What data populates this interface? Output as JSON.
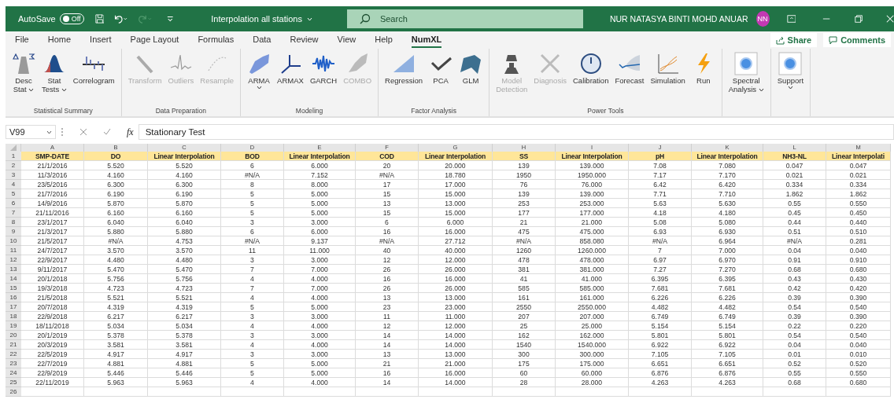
{
  "title_bar": {
    "autosave_label": "AutoSave",
    "autosave": {
      "on": false,
      "label": "Off"
    },
    "filename": "Interpolation all stations",
    "search": {
      "placeholder": "Search"
    },
    "user_name": "NUR NATASYA BINTI MOHD ANUAR",
    "avatar_initials": "NN"
  },
  "menu_tabs": [
    {
      "label": "File",
      "selected": false
    },
    {
      "label": "Home",
      "selected": false
    },
    {
      "label": "Insert",
      "selected": false
    },
    {
      "label": "Page Layout",
      "selected": false
    },
    {
      "label": "Formulas",
      "selected": false
    },
    {
      "label": "Data",
      "selected": false
    },
    {
      "label": "Review",
      "selected": false
    },
    {
      "label": "View",
      "selected": false
    },
    {
      "label": "Help",
      "selected": false
    },
    {
      "label": "NumXL",
      "selected": true
    }
  ],
  "share_button": "Share",
  "comments_button": "Comments",
  "ribbon_groups": [
    {
      "label": "Statistical Summary",
      "items": [
        {
          "lines": [
            "Desc",
            "Stat"
          ],
          "disabled": false,
          "dropdown": true
        },
        {
          "lines": [
            "Stat",
            "Tests"
          ],
          "disabled": false,
          "dropdown": true
        },
        {
          "lines": [
            "Correlogram"
          ],
          "disabled": false,
          "dropdown": false
        }
      ]
    },
    {
      "label": "Data Preparation",
      "items": [
        {
          "lines": [
            "Transform"
          ],
          "disabled": true,
          "dropdown": false
        },
        {
          "lines": [
            "Outliers"
          ],
          "disabled": true,
          "dropdown": false
        },
        {
          "lines": [
            "Resample"
          ],
          "disabled": true,
          "dropdown": false
        }
      ]
    },
    {
      "label": "Modeling",
      "items": [
        {
          "lines": [
            "ARMA"
          ],
          "disabled": false,
          "dropdown": true
        },
        {
          "lines": [
            "ARMAX"
          ],
          "disabled": false,
          "dropdown": false
        },
        {
          "lines": [
            "GARCH"
          ],
          "disabled": false,
          "dropdown": false
        },
        {
          "lines": [
            "COMBO"
          ],
          "disabled": true,
          "dropdown": false
        }
      ]
    },
    {
      "label": "Factor Analysis",
      "items": [
        {
          "lines": [
            "Regression"
          ],
          "disabled": false,
          "dropdown": false
        },
        {
          "lines": [
            "PCA"
          ],
          "disabled": false,
          "dropdown": false
        },
        {
          "lines": [
            "GLM"
          ],
          "disabled": false,
          "dropdown": false
        }
      ]
    },
    {
      "label": "Power Tools",
      "items": [
        {
          "lines": [
            "Model",
            "Detection"
          ],
          "disabled": true,
          "dropdown": false
        },
        {
          "lines": [
            "Diagnosis"
          ],
          "disabled": true,
          "dropdown": false
        },
        {
          "lines": [
            "Calibration"
          ],
          "disabled": false,
          "dropdown": false
        },
        {
          "lines": [
            "Forecast"
          ],
          "disabled": false,
          "dropdown": false
        },
        {
          "lines": [
            "Simulation"
          ],
          "disabled": false,
          "dropdown": false
        },
        {
          "lines": [
            "Run"
          ],
          "disabled": false,
          "dropdown": false
        }
      ]
    },
    {
      "items": [
        {
          "lines": [
            "Spectral",
            "Analysis"
          ],
          "disabled": false,
          "dropdown": true
        }
      ]
    },
    {
      "items": [
        {
          "lines": [
            "Support"
          ],
          "disabled": false,
          "dropdown": true
        }
      ]
    }
  ],
  "formula_bar": {
    "cell_reference": "V99",
    "function_symbol": "fx",
    "formula": "Stationary Test"
  },
  "sheet": {
    "columns": [
      "A",
      "B",
      "C",
      "D",
      "E",
      "F",
      "G",
      "H",
      "I",
      "J",
      "K",
      "L",
      "M"
    ],
    "header": {
      "number": "1",
      "cells": [
        "SMP-DATE",
        "DO",
        "Linear Interpolation",
        "BOD",
        "Linear Interpolation",
        "COD",
        "Linear Interpolation",
        "SS",
        "Linear Interpolation",
        "pH",
        "Linear Interpolation",
        "NH3-NL",
        "Linear Interpolati"
      ]
    },
    "rows": [
      {
        "number": "2",
        "cells": [
          "21/1/2016",
          "5.520",
          "5.520",
          "6",
          "6.000",
          "20",
          "20.000",
          "139",
          "139.000",
          "7.08",
          "7.080",
          "0.047",
          "0.047"
        ]
      },
      {
        "number": "3",
        "cells": [
          "11/3/2016",
          "4.160",
          "4.160",
          "#N/A",
          "7.152",
          "#N/A",
          "18.780",
          "1950",
          "1950.000",
          "7.17",
          "7.170",
          "0.021",
          "0.021"
        ]
      },
      {
        "number": "4",
        "cells": [
          "23/5/2016",
          "6.300",
          "6.300",
          "8",
          "8.000",
          "17",
          "17.000",
          "76",
          "76.000",
          "6.42",
          "6.420",
          "0.334",
          "0.334"
        ]
      },
      {
        "number": "5",
        "cells": [
          "21/7/2016",
          "6.190",
          "6.190",
          "5",
          "5.000",
          "15",
          "15.000",
          "139",
          "139.000",
          "7.71",
          "7.710",
          "1.862",
          "1.862"
        ]
      },
      {
        "number": "6",
        "cells": [
          "14/9/2016",
          "5.870",
          "5.870",
          "5",
          "5.000",
          "13",
          "13.000",
          "253",
          "253.000",
          "5.63",
          "5.630",
          "0.55",
          "0.550"
        ]
      },
      {
        "number": "7",
        "cells": [
          "21/11/2016",
          "6.160",
          "6.160",
          "5",
          "5.000",
          "15",
          "15.000",
          "177",
          "177.000",
          "4.18",
          "4.180",
          "0.45",
          "0.450"
        ]
      },
      {
        "number": "8",
        "cells": [
          "23/1/2017",
          "6.040",
          "6.040",
          "3",
          "3.000",
          "6",
          "6.000",
          "21",
          "21.000",
          "5.08",
          "5.080",
          "0.44",
          "0.440"
        ]
      },
      {
        "number": "9",
        "cells": [
          "21/3/2017",
          "5.880",
          "5.880",
          "6",
          "6.000",
          "16",
          "16.000",
          "475",
          "475.000",
          "6.93",
          "6.930",
          "0.51",
          "0.510"
        ]
      },
      {
        "number": "10",
        "cells": [
          "21/5/2017",
          "#N/A",
          "4.753",
          "#N/A",
          "9.137",
          "#N/A",
          "27.712",
          "#N/A",
          "858.080",
          "#N/A",
          "6.964",
          "#N/A",
          "0.281"
        ]
      },
      {
        "number": "11",
        "cells": [
          "24/7/2017",
          "3.570",
          "3.570",
          "11",
          "11.000",
          "40",
          "40.000",
          "1260",
          "1260.000",
          "7",
          "7.000",
          "0.04",
          "0.040"
        ]
      },
      {
        "number": "12",
        "cells": [
          "22/9/2017",
          "4.480",
          "4.480",
          "3",
          "3.000",
          "12",
          "12.000",
          "478",
          "478.000",
          "6.97",
          "6.970",
          "0.91",
          "0.910"
        ]
      },
      {
        "number": "13",
        "cells": [
          "9/11/2017",
          "5.470",
          "5.470",
          "7",
          "7.000",
          "26",
          "26.000",
          "381",
          "381.000",
          "7.27",
          "7.270",
          "0.68",
          "0.680"
        ]
      },
      {
        "number": "14",
        "cells": [
          "20/1/2018",
          "5.756",
          "5.756",
          "4",
          "4.000",
          "16",
          "16.000",
          "41",
          "41.000",
          "6.395",
          "6.395",
          "0.43",
          "0.430"
        ]
      },
      {
        "number": "15",
        "cells": [
          "19/3/2018",
          "4.723",
          "4.723",
          "7",
          "7.000",
          "26",
          "26.000",
          "585",
          "585.000",
          "7.681",
          "7.681",
          "0.42",
          "0.420"
        ]
      },
      {
        "number": "16",
        "cells": [
          "21/5/2018",
          "5.521",
          "5.521",
          "4",
          "4.000",
          "13",
          "13.000",
          "161",
          "161.000",
          "6.226",
          "6.226",
          "0.39",
          "0.390"
        ]
      },
      {
        "number": "17",
        "cells": [
          "20/7/2018",
          "4.319",
          "4.319",
          "5",
          "5.000",
          "23",
          "23.000",
          "2550",
          "2550.000",
          "4.482",
          "4.482",
          "0.54",
          "0.540"
        ]
      },
      {
        "number": "18",
        "cells": [
          "22/9/2018",
          "6.217",
          "6.217",
          "3",
          "3.000",
          "11",
          "11.000",
          "207",
          "207.000",
          "6.749",
          "6.749",
          "0.39",
          "0.390"
        ]
      },
      {
        "number": "19",
        "cells": [
          "18/11/2018",
          "5.034",
          "5.034",
          "4",
          "4.000",
          "12",
          "12.000",
          "25",
          "25.000",
          "5.154",
          "5.154",
          "0.22",
          "0.220"
        ]
      },
      {
        "number": "20",
        "cells": [
          "20/1/2019",
          "5.378",
          "5.378",
          "3",
          "3.000",
          "14",
          "14.000",
          "162",
          "162.000",
          "5.801",
          "5.801",
          "0.54",
          "0.540"
        ]
      },
      {
        "number": "21",
        "cells": [
          "20/3/2019",
          "3.581",
          "3.581",
          "4",
          "4.000",
          "14",
          "14.000",
          "1540",
          "1540.000",
          "6.922",
          "6.922",
          "0.04",
          "0.040"
        ]
      },
      {
        "number": "22",
        "cells": [
          "22/5/2019",
          "4.917",
          "4.917",
          "3",
          "3.000",
          "13",
          "13.000",
          "300",
          "300.000",
          "7.105",
          "7.105",
          "0.01",
          "0.010"
        ]
      },
      {
        "number": "23",
        "cells": [
          "22/7/2019",
          "4.881",
          "4.881",
          "5",
          "5.000",
          "21",
          "21.000",
          "175",
          "175.000",
          "6.651",
          "6.651",
          "0.52",
          "0.520"
        ]
      },
      {
        "number": "24",
        "cells": [
          "22/9/2019",
          "5.446",
          "5.446",
          "5",
          "5.000",
          "16",
          "16.000",
          "60",
          "60.000",
          "6.876",
          "6.876",
          "0.55",
          "0.550"
        ]
      },
      {
        "number": "25",
        "cells": [
          "22/11/2019",
          "5.963",
          "5.963",
          "4",
          "4.000",
          "14",
          "14.000",
          "28",
          "28.000",
          "4.263",
          "4.263",
          "0.68",
          "0.680"
        ]
      }
    ],
    "empty_row_number": "26"
  }
}
